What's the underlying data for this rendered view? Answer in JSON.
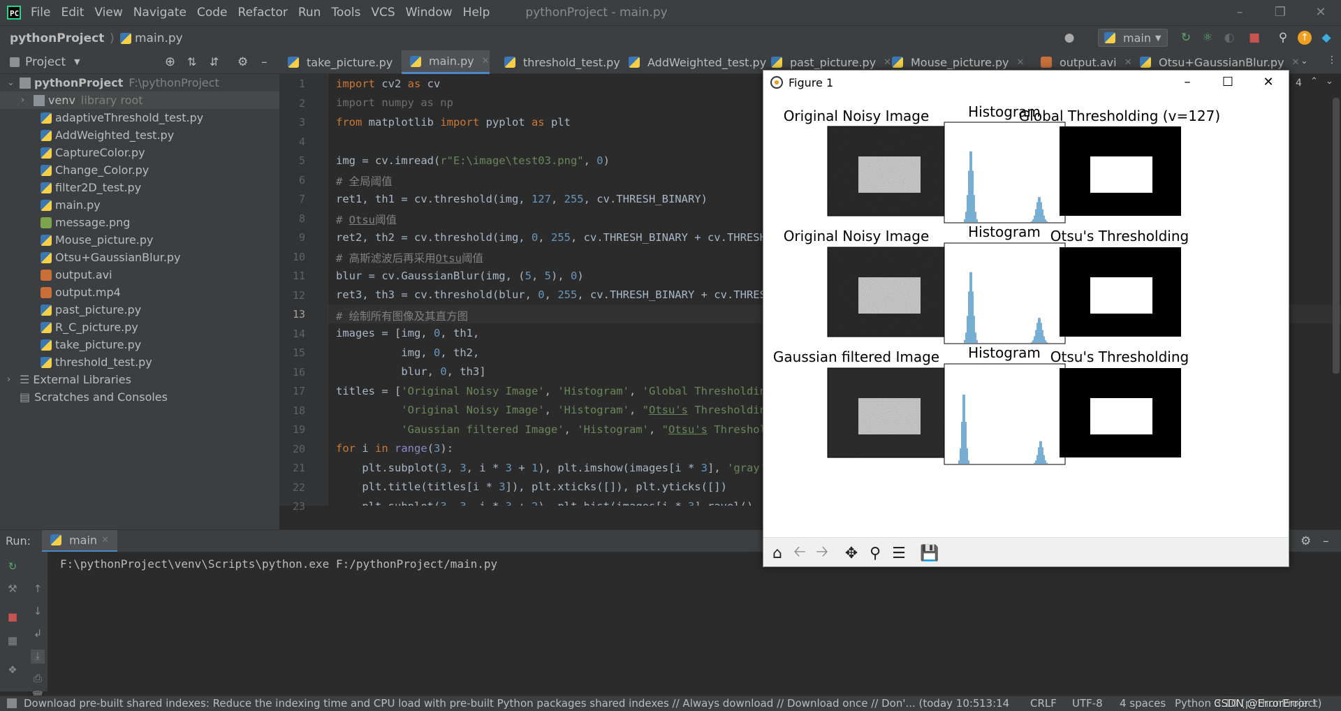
{
  "menubar": {
    "items": [
      "File",
      "Edit",
      "View",
      "Navigate",
      "Code",
      "Refactor",
      "Run",
      "Tools",
      "VCS",
      "Window",
      "Help"
    ],
    "window_title": "pythonProject - main.py"
  },
  "navbar": {
    "project": "pythonProject",
    "file": "main.py",
    "run_config": "main"
  },
  "project_panel": {
    "title": "Project",
    "root": "pythonProject",
    "root_path": "F:\\pythonProject",
    "venv": "venv",
    "venv_note": "library root",
    "files": [
      "adaptiveThreshold_test.py",
      "AddWeighted_test.py",
      "CaptureColor.py",
      "Change_Color.py",
      "filter2D_test.py",
      "main.py",
      "message.png",
      "Mouse_picture.py",
      "Otsu+GaussianBlur.py",
      "output.avi",
      "output.mp4",
      "past_picture.py",
      "R_C_picture.py",
      "take_picture.py",
      "threshold_test.py"
    ],
    "external": "External Libraries",
    "scratches": "Scratches and Consoles"
  },
  "tabs": [
    "take_picture.py",
    "main.py",
    "threshold_test.py",
    "AddWeighted_test.py",
    "past_picture.py",
    "Mouse_picture.py",
    "output.avi",
    "Otsu+GaussianBlur.py"
  ],
  "inspections_count": "4",
  "line_numbers": [
    "1",
    "2",
    "3",
    "4",
    "5",
    "6",
    "7",
    "8",
    "9",
    "10",
    "11",
    "12",
    "13",
    "14",
    "15",
    "16",
    "17",
    "18",
    "19",
    "20",
    "21",
    "22",
    "23"
  ],
  "figure": {
    "title": "Figure 1",
    "titles": [
      "Original Noisy Image",
      "Histogram",
      "Global Thresholding (v=127)",
      "Original Noisy Image",
      "Histogram",
      "Otsu's Thresholding",
      "Gaussian filtered Image",
      "Histogram",
      "Otsu's Thresholding"
    ]
  },
  "run": {
    "label": "Run:",
    "tab": "main",
    "command": "F:\\pythonProject\\venv\\Scripts\\python.exe F:/pythonProject/main.py"
  },
  "status": {
    "message": "Download pre-built shared indexes: Reduce the indexing time and CPU load with pre-built Python packages shared indexes // Always download // Download once // Don'... (today 10:5",
    "position": "13:14",
    "line_sep": "CRLF",
    "encoding": "UTF-8",
    "indent": "4 spaces",
    "interpreter": "Python 3.10 (pythonProject)",
    "watermark": "CSDN @ErrorError !"
  }
}
